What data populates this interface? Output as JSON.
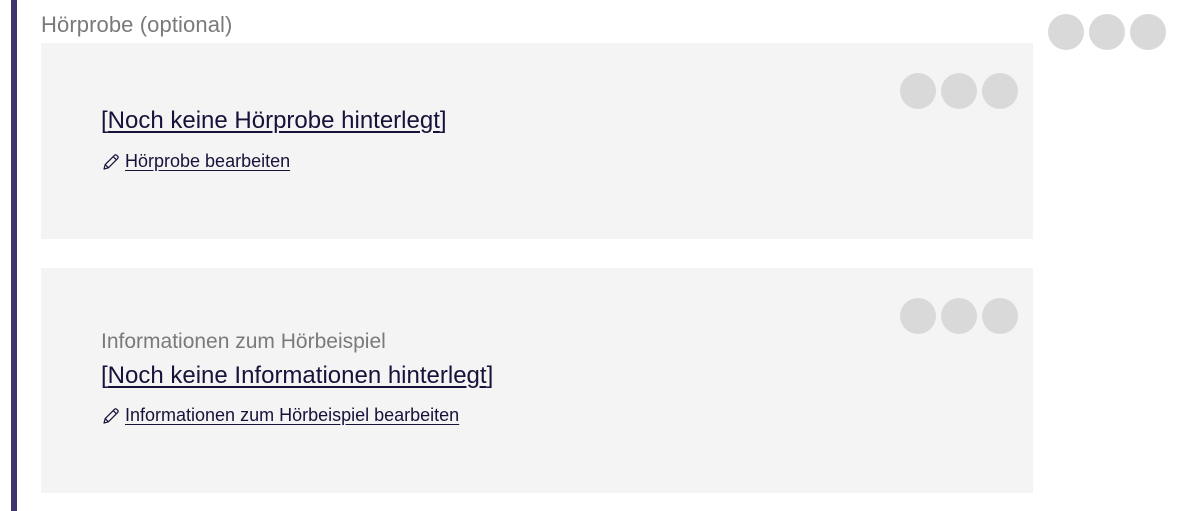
{
  "section": {
    "title": "Hörprobe (optional)"
  },
  "card_audio": {
    "placeholder": "Noch keine Hörprobe hinterlegt",
    "edit_label": "Hörprobe bearbeiten",
    "bracket_open": "[",
    "bracket_close": "]"
  },
  "card_info": {
    "heading": "Informationen zum Hörbeispiel",
    "placeholder": "Noch keine Informationen hinterlegt",
    "edit_label": "Informationen zum Hörbeispiel bearbeiten",
    "bracket_open": "[",
    "bracket_close": "]"
  },
  "icons": {
    "edit": "pencil-icon",
    "menu_dot": "circle-dot"
  },
  "colors": {
    "accent": "#3d3470",
    "link": "#16123a",
    "muted_text": "#7a7a7a",
    "card_bg": "#f4f4f4",
    "dot": "#d9d9d9"
  }
}
